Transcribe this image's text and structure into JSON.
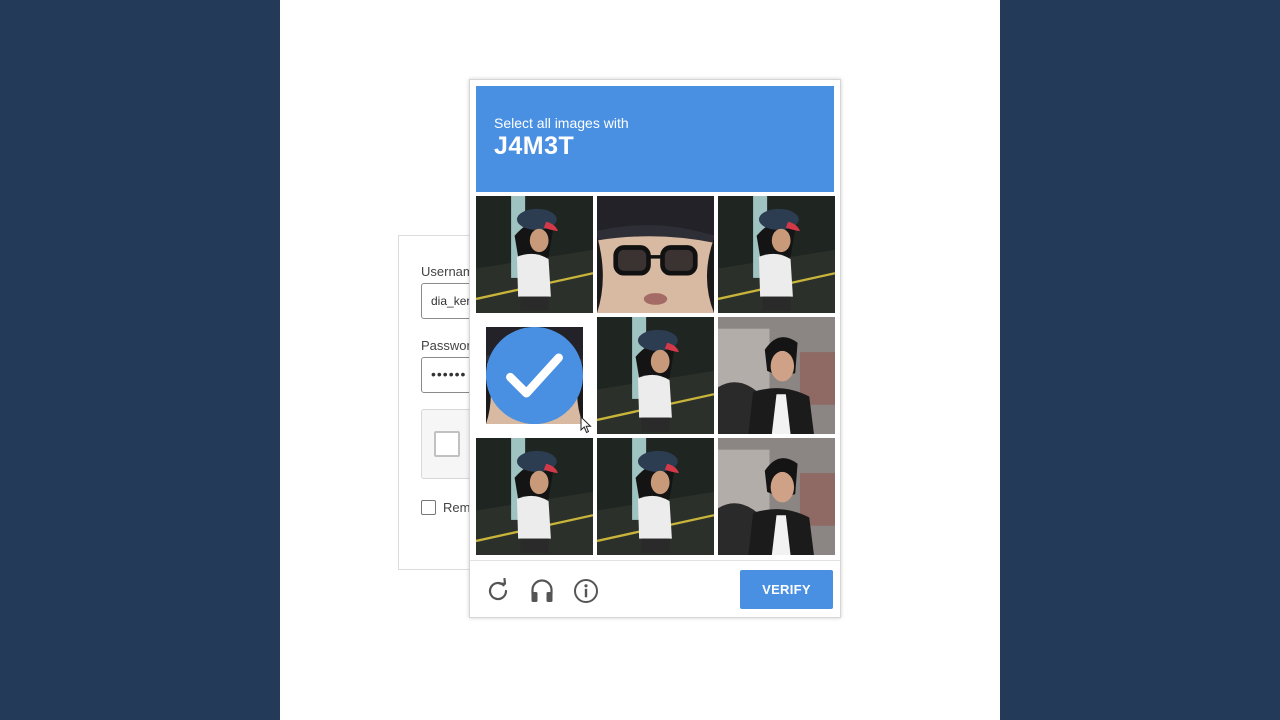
{
  "login": {
    "username_label": "Usernam",
    "username_value": "dia_kere",
    "password_label": "Passwor",
    "password_value": "••••••",
    "remember_label": "Rem"
  },
  "challenge": {
    "instruction": "Select all images with",
    "target": "J4M3T",
    "verify_label": "VERIFY",
    "tiles": [
      {
        "scene": "street-cap",
        "selected": false
      },
      {
        "scene": "closeup-glasses",
        "selected": false
      },
      {
        "scene": "street-cap",
        "selected": false
      },
      {
        "scene": "closeup-glasses",
        "selected": true
      },
      {
        "scene": "street-cap",
        "selected": false
      },
      {
        "scene": "bedroom-selfie",
        "selected": false
      },
      {
        "scene": "street-cap",
        "selected": false
      },
      {
        "scene": "street-cap",
        "selected": false
      },
      {
        "scene": "bedroom-selfie",
        "selected": false
      }
    ],
    "footer_icons": [
      "refresh-icon",
      "headphones-icon",
      "info-icon"
    ]
  },
  "colors": {
    "background": "#233a58",
    "accent": "#4a90e2",
    "page": "#ffffff"
  }
}
